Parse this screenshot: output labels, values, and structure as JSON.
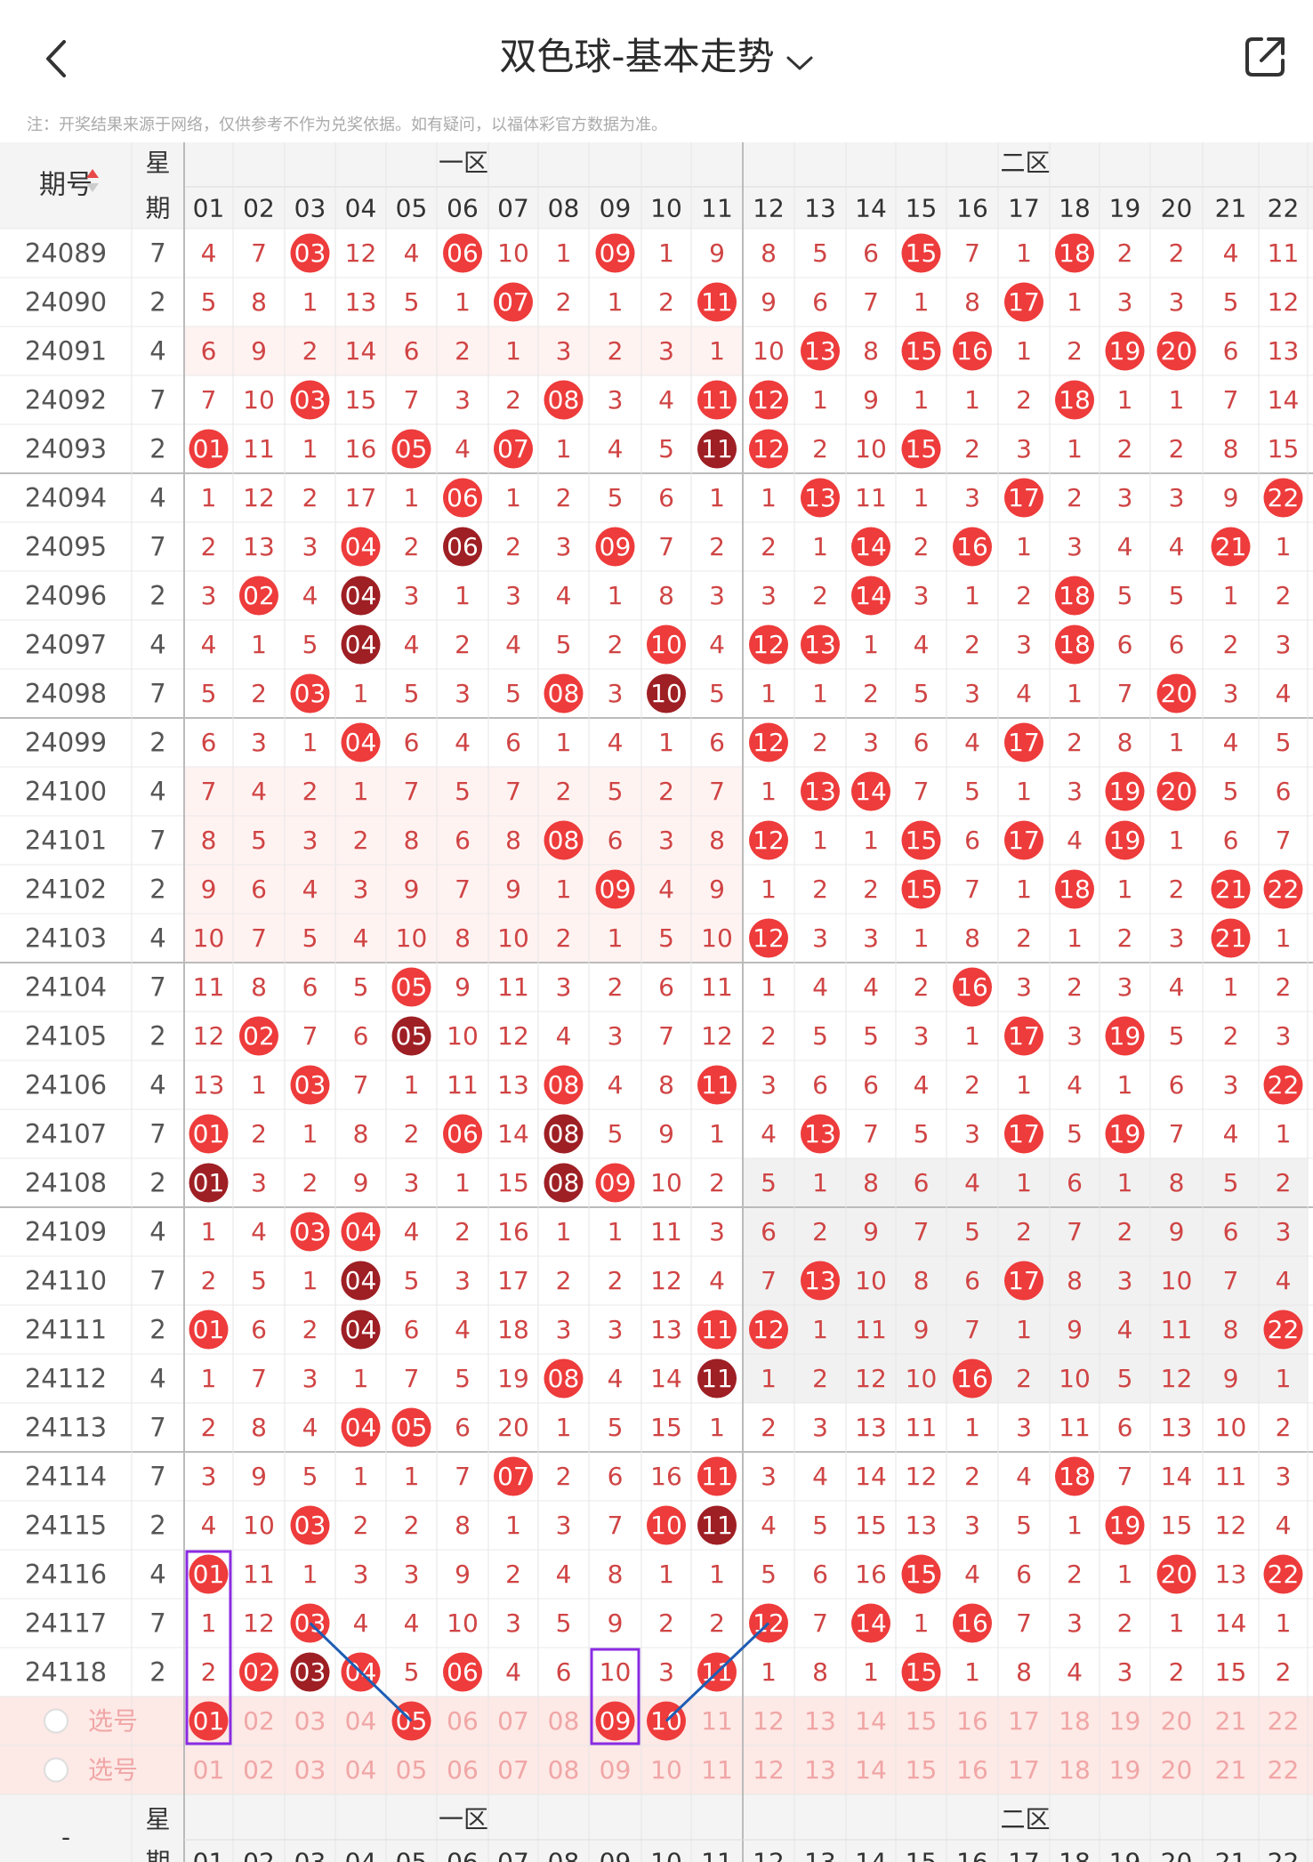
{
  "header": {
    "title": "双色球-基本走势",
    "share_icon": "share-icon",
    "back_icon": "back-arrow-icon"
  },
  "note": "注：开奖结果来源于网络，仅供参考不作为兑奖依据。如有疑问，以福体彩官方数据为准。",
  "table": {
    "col_period": "期号",
    "col_week_top": "星",
    "col_week_bottom": "期",
    "zone1": "一区",
    "zone2": "二区",
    "numbers": [
      "01",
      "02",
      "03",
      "04",
      "05",
      "06",
      "07",
      "08",
      "09",
      "10",
      "11",
      "12",
      "13",
      "14",
      "15",
      "16",
      "17",
      "18",
      "19",
      "20",
      "21",
      "22"
    ],
    "rows": [
      {
        "period": "24089",
        "week": "7",
        "cells": [
          4,
          7,
          "03",
          12,
          4,
          "06",
          10,
          1,
          "09",
          1,
          9,
          8,
          5,
          6,
          "15",
          7,
          1,
          "18",
          2,
          2,
          4,
          11
        ]
      },
      {
        "period": "24090",
        "week": "2",
        "cells": [
          5,
          8,
          1,
          13,
          5,
          1,
          "07",
          2,
          1,
          2,
          "11",
          9,
          6,
          7,
          1,
          8,
          "17",
          1,
          3,
          3,
          5,
          12
        ]
      },
      {
        "period": "24091",
        "week": "4",
        "cells": [
          6,
          9,
          2,
          14,
          6,
          2,
          1,
          3,
          2,
          3,
          1,
          10,
          "13",
          8,
          "15",
          "16",
          1,
          2,
          "19",
          "20",
          6,
          13
        ]
      },
      {
        "period": "24092",
        "week": "7",
        "cells": [
          7,
          10,
          "03",
          15,
          7,
          3,
          2,
          "08",
          3,
          4,
          "11",
          "12",
          1,
          9,
          1,
          1,
          2,
          "18",
          1,
          1,
          7,
          14
        ]
      },
      {
        "period": "24093",
        "week": "2",
        "cells": [
          "01",
          11,
          1,
          16,
          "05",
          4,
          "07",
          1,
          4,
          5,
          "11",
          "12",
          2,
          10,
          "15",
          2,
          3,
          1,
          2,
          2,
          8,
          15
        ]
      },
      {
        "period": "24094",
        "week": "4",
        "cells": [
          1,
          12,
          2,
          17,
          1,
          "06",
          1,
          2,
          5,
          6,
          1,
          1,
          "13",
          11,
          1,
          3,
          "17",
          2,
          3,
          3,
          9,
          "22"
        ]
      },
      {
        "period": "24095",
        "week": "7",
        "cells": [
          2,
          13,
          3,
          "04",
          2,
          "06",
          2,
          3,
          "09",
          7,
          2,
          2,
          1,
          "14",
          2,
          "16",
          1,
          3,
          4,
          4,
          "21",
          1
        ]
      },
      {
        "period": "24096",
        "week": "2",
        "cells": [
          3,
          "02",
          4,
          "04",
          3,
          1,
          3,
          4,
          1,
          8,
          3,
          3,
          2,
          "14",
          3,
          1,
          2,
          "18",
          5,
          5,
          1,
          2
        ]
      },
      {
        "period": "24097",
        "week": "4",
        "cells": [
          4,
          1,
          5,
          "04",
          4,
          2,
          4,
          5,
          2,
          "10",
          4,
          "12",
          "13",
          1,
          4,
          2,
          3,
          "18",
          6,
          6,
          2,
          3
        ]
      },
      {
        "period": "24098",
        "week": "7",
        "cells": [
          5,
          2,
          "03",
          1,
          5,
          3,
          5,
          "08",
          3,
          "10",
          5,
          1,
          1,
          2,
          5,
          3,
          4,
          1,
          7,
          "20",
          3,
          4
        ]
      },
      {
        "period": "24099",
        "week": "2",
        "cells": [
          6,
          3,
          1,
          "04",
          6,
          4,
          6,
          1,
          4,
          1,
          6,
          "12",
          2,
          3,
          6,
          4,
          "17",
          2,
          8,
          1,
          4,
          5
        ]
      },
      {
        "period": "24100",
        "week": "4",
        "cells": [
          7,
          4,
          2,
          1,
          7,
          5,
          7,
          2,
          5,
          2,
          7,
          1,
          "13",
          "14",
          7,
          5,
          1,
          3,
          "19",
          "20",
          5,
          6
        ]
      },
      {
        "period": "24101",
        "week": "7",
        "cells": [
          8,
          5,
          3,
          2,
          8,
          6,
          8,
          "08",
          6,
          3,
          8,
          "12",
          1,
          1,
          "15",
          6,
          "17",
          4,
          "19",
          1,
          6,
          7
        ]
      },
      {
        "period": "24102",
        "week": "2",
        "cells": [
          9,
          6,
          4,
          3,
          9,
          7,
          9,
          1,
          "09",
          4,
          9,
          1,
          2,
          2,
          "15",
          7,
          1,
          "18",
          1,
          2,
          "21",
          "22"
        ]
      },
      {
        "period": "24103",
        "week": "4",
        "cells": [
          10,
          7,
          5,
          4,
          10,
          8,
          10,
          2,
          1,
          5,
          10,
          "12",
          3,
          3,
          1,
          8,
          2,
          1,
          2,
          3,
          "21",
          1
        ]
      },
      {
        "period": "24104",
        "week": "7",
        "cells": [
          11,
          8,
          6,
          5,
          "05",
          9,
          11,
          3,
          2,
          6,
          11,
          1,
          4,
          4,
          2,
          "16",
          3,
          2,
          3,
          4,
          1,
          2
        ]
      },
      {
        "period": "24105",
        "week": "2",
        "cells": [
          12,
          "02",
          7,
          6,
          "05",
          10,
          12,
          4,
          3,
          7,
          12,
          2,
          5,
          5,
          3,
          1,
          "17",
          3,
          "19",
          5,
          2,
          3
        ]
      },
      {
        "period": "24106",
        "week": "4",
        "cells": [
          13,
          1,
          "03",
          7,
          1,
          11,
          13,
          "08",
          4,
          8,
          "11",
          3,
          6,
          6,
          4,
          2,
          1,
          4,
          1,
          6,
          3,
          "22"
        ]
      },
      {
        "period": "24107",
        "week": "7",
        "cells": [
          "01",
          2,
          1,
          8,
          2,
          "06",
          14,
          "08",
          5,
          9,
          1,
          4,
          "13",
          7,
          5,
          3,
          "17",
          5,
          "19",
          7,
          4,
          1
        ]
      },
      {
        "period": "24108",
        "week": "2",
        "cells": [
          "01",
          3,
          2,
          9,
          3,
          1,
          15,
          "08",
          "09",
          10,
          2,
          5,
          1,
          8,
          6,
          4,
          1,
          6,
          1,
          8,
          5,
          2
        ]
      },
      {
        "period": "24109",
        "week": "4",
        "cells": [
          1,
          4,
          "03",
          "04",
          4,
          2,
          16,
          1,
          1,
          11,
          3,
          6,
          2,
          9,
          7,
          5,
          2,
          7,
          2,
          9,
          6,
          3
        ]
      },
      {
        "period": "24110",
        "week": "7",
        "cells": [
          2,
          5,
          1,
          "04",
          5,
          3,
          17,
          2,
          2,
          12,
          4,
          7,
          "13",
          10,
          8,
          6,
          "17",
          8,
          3,
          10,
          7,
          4
        ]
      },
      {
        "period": "24111",
        "week": "2",
        "cells": [
          "01",
          6,
          2,
          "04",
          6,
          4,
          18,
          3,
          3,
          13,
          "11",
          "12",
          1,
          11,
          9,
          7,
          1,
          9,
          4,
          11,
          8,
          "22"
        ]
      },
      {
        "period": "24112",
        "week": "4",
        "cells": [
          1,
          7,
          3,
          1,
          7,
          5,
          19,
          "08",
          4,
          14,
          "11",
          1,
          2,
          12,
          10,
          "16",
          2,
          10,
          5,
          12,
          9,
          1
        ]
      },
      {
        "period": "24113",
        "week": "7",
        "cells": [
          2,
          8,
          4,
          "04",
          "05",
          6,
          20,
          1,
          5,
          15,
          1,
          2,
          3,
          13,
          11,
          1,
          3,
          11,
          6,
          13,
          10,
          2
        ]
      },
      {
        "period": "24114",
        "week": "7",
        "cells": [
          3,
          9,
          5,
          1,
          1,
          7,
          "07",
          2,
          6,
          16,
          "11",
          3,
          4,
          14,
          12,
          2,
          4,
          "18",
          7,
          14,
          11,
          3
        ]
      },
      {
        "period": "24115",
        "week": "2",
        "cells": [
          4,
          10,
          "03",
          2,
          2,
          8,
          1,
          3,
          7,
          "10",
          "11",
          4,
          5,
          15,
          13,
          3,
          5,
          1,
          "19",
          15,
          12,
          4
        ]
      },
      {
        "period": "24116",
        "week": "4",
        "cells": [
          "01",
          11,
          1,
          3,
          3,
          9,
          2,
          4,
          8,
          1,
          1,
          5,
          6,
          16,
          "15",
          4,
          6,
          2,
          1,
          "20",
          13,
          "22"
        ]
      },
      {
        "period": "24117",
        "week": "7",
        "cells": [
          1,
          12,
          "03",
          4,
          4,
          10,
          3,
          5,
          9,
          2,
          2,
          "12",
          7,
          "14",
          1,
          "16",
          7,
          3,
          2,
          1,
          14,
          1
        ]
      },
      {
        "period": "24118",
        "week": "2",
        "cells": [
          2,
          "02",
          "03",
          "04",
          5,
          "06",
          4,
          6,
          10,
          3,
          "11",
          1,
          8,
          1,
          "15",
          1,
          8,
          4,
          3,
          2,
          15,
          2
        ]
      }
    ],
    "select_label": "选号",
    "footer_period": "-"
  },
  "colors": {
    "ball_red": "#ee3b3b",
    "ball_dark": "#9e1f24",
    "miss_text": "#d04444",
    "select_text": "#f0a6a6",
    "select_bg": "#fde9e6",
    "grey_band": "#f1f1f1",
    "highlight_purple": "#8a2be2",
    "line_blue": "#1f5db4"
  }
}
